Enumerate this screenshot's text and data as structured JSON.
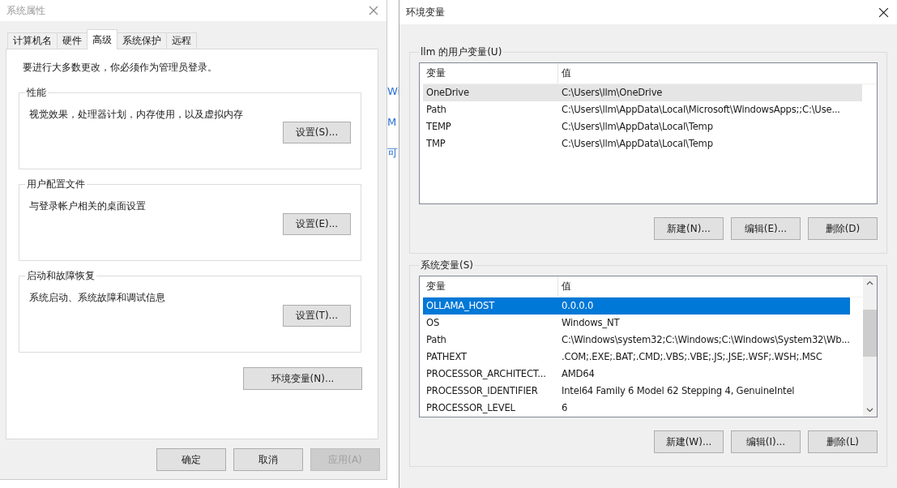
{
  "system_properties": {
    "title": "系统属性",
    "tabs": [
      {
        "label": "计算机名",
        "selected": false
      },
      {
        "label": "硬件",
        "selected": false
      },
      {
        "label": "高级",
        "selected": true
      },
      {
        "label": "系统保护",
        "selected": false
      },
      {
        "label": "远程",
        "selected": false
      }
    ],
    "admin_note": "要进行大多数更改，你必须作为管理员登录。",
    "groups": [
      {
        "title": "性能",
        "description": "视觉效果，处理器计划，内存使用，以及虚拟内存",
        "button": "设置(S)..."
      },
      {
        "title": "用户配置文件",
        "description": "与登录帐户相关的桌面设置",
        "button": "设置(E)..."
      },
      {
        "title": "启动和故障恢复",
        "description": "系统启动、系统故障和调试信息",
        "button": "设置(T)..."
      }
    ],
    "env_button": "环境变量(N)...",
    "footer_buttons": [
      {
        "label": "确定",
        "disabled": false
      },
      {
        "label": "取消",
        "disabled": false
      },
      {
        "label": "应用(A)",
        "disabled": true
      }
    ]
  },
  "background_window": {
    "fragments": [
      "Wi",
      "M",
      "可"
    ]
  },
  "environment_variables": {
    "title": "环境变量",
    "user_vars": {
      "title": "llm 的用户变量(U)",
      "columns": [
        "变量",
        "值"
      ],
      "rows": [
        {
          "name": "OneDrive",
          "value": "C:\\Users\\llm\\OneDrive",
          "selected": false,
          "hovered": true
        },
        {
          "name": "Path",
          "value": "C:\\Users\\llm\\AppData\\Local\\Microsoft\\WindowsApps;;C:\\Use...",
          "selected": false,
          "hovered": false
        },
        {
          "name": "TEMP",
          "value": "C:\\Users\\llm\\AppData\\Local\\Temp",
          "selected": false,
          "hovered": false
        },
        {
          "name": "TMP",
          "value": "C:\\Users\\llm\\AppData\\Local\\Temp",
          "selected": false,
          "hovered": false
        }
      ],
      "buttons": [
        "新建(N)...",
        "编辑(E)...",
        "删除(D)"
      ]
    },
    "system_vars": {
      "title": "系统变量(S)",
      "columns": [
        "变量",
        "值"
      ],
      "rows": [
        {
          "name": "OLLAMA_HOST",
          "value": "0.0.0.0",
          "selected": true,
          "hovered": false
        },
        {
          "name": "OS",
          "value": "Windows_NT",
          "selected": false,
          "hovered": false
        },
        {
          "name": "Path",
          "value": "C:\\Windows\\system32;C:\\Windows;C:\\Windows\\System32\\Wb...",
          "selected": false,
          "hovered": false
        },
        {
          "name": "PATHEXT",
          "value": ".COM;.EXE;.BAT;.CMD;.VBS;.VBE;.JS;.JSE;.WSF;.WSH;.MSC",
          "selected": false,
          "hovered": false
        },
        {
          "name": "PROCESSOR_ARCHITECT...",
          "value": "AMD64",
          "selected": false,
          "hovered": false
        },
        {
          "name": "PROCESSOR_IDENTIFIER",
          "value": "Intel64 Family 6 Model 62 Stepping 4, GenuineIntel",
          "selected": false,
          "hovered": false
        },
        {
          "name": "PROCESSOR_LEVEL",
          "value": "6",
          "selected": false,
          "hovered": false
        }
      ],
      "buttons": [
        "新建(W)...",
        "编辑(I)...",
        "删除(L)"
      ]
    }
  }
}
